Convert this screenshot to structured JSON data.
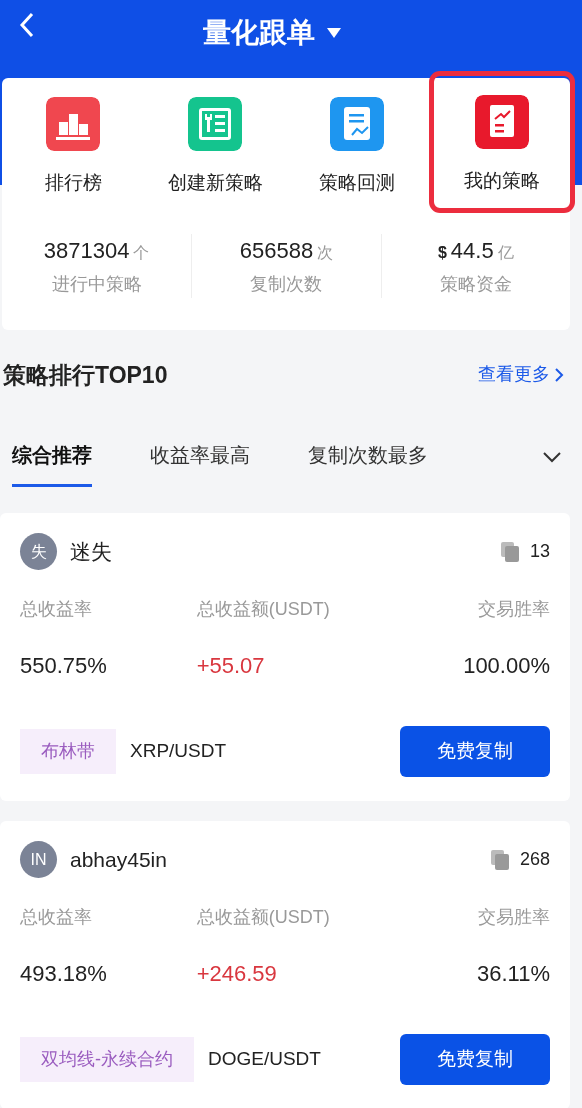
{
  "header": {
    "title": "量化跟单"
  },
  "actions": [
    {
      "label": "排行榜",
      "kind": "podium",
      "highlighted": false
    },
    {
      "label": "创建新策略",
      "kind": "builder",
      "highlighted": false
    },
    {
      "label": "策略回测",
      "kind": "backtest",
      "highlighted": false
    },
    {
      "label": "我的策略",
      "kind": "mine",
      "highlighted": true
    }
  ],
  "stats": [
    {
      "value": "3871304",
      "unit": "个",
      "label": "进行中策略"
    },
    {
      "value": "656588",
      "unit": "次",
      "label": "复制次数"
    },
    {
      "prefix": "$",
      "value": "44.5",
      "unit": "亿",
      "label": "策略资金"
    }
  ],
  "section": {
    "title": "策略排行TOP10",
    "more": "查看更多"
  },
  "tabs": [
    {
      "label": "综合推荐",
      "selected": true
    },
    {
      "label": "收益率最高",
      "selected": false
    },
    {
      "label": "复制次数最多",
      "selected": false
    }
  ],
  "strategies": [
    {
      "avatar": "失",
      "name": "迷失",
      "copies": "13",
      "metric_labels": [
        "总收益率",
        "总收益额(USDT)",
        "交易胜率"
      ],
      "metrics": [
        "550.75%",
        "+55.07",
        "100.00%"
      ],
      "tag": "布林带",
      "pair": "XRP/USDT",
      "button": "免费复制"
    },
    {
      "avatar": "IN",
      "name": "abhay45in",
      "copies": "268",
      "metric_labels": [
        "总收益率",
        "总收益额(USDT)",
        "交易胜率"
      ],
      "metrics": [
        "493.18%",
        "+246.59",
        "36.11%"
      ],
      "tag": "双均线-永续合约",
      "pair": "DOGE/USDT",
      "button": "免费复制"
    }
  ]
}
